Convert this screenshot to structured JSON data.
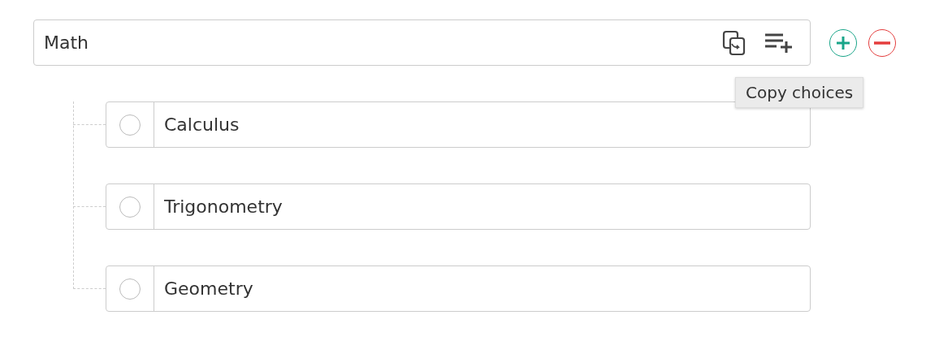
{
  "question": {
    "value": "Math"
  },
  "tooltip": {
    "text": "Copy choices"
  },
  "choices": [
    {
      "value": "Calculus",
      "selected": false
    },
    {
      "value": "Trigonometry",
      "selected": false
    },
    {
      "value": "Geometry",
      "selected": false
    }
  ]
}
